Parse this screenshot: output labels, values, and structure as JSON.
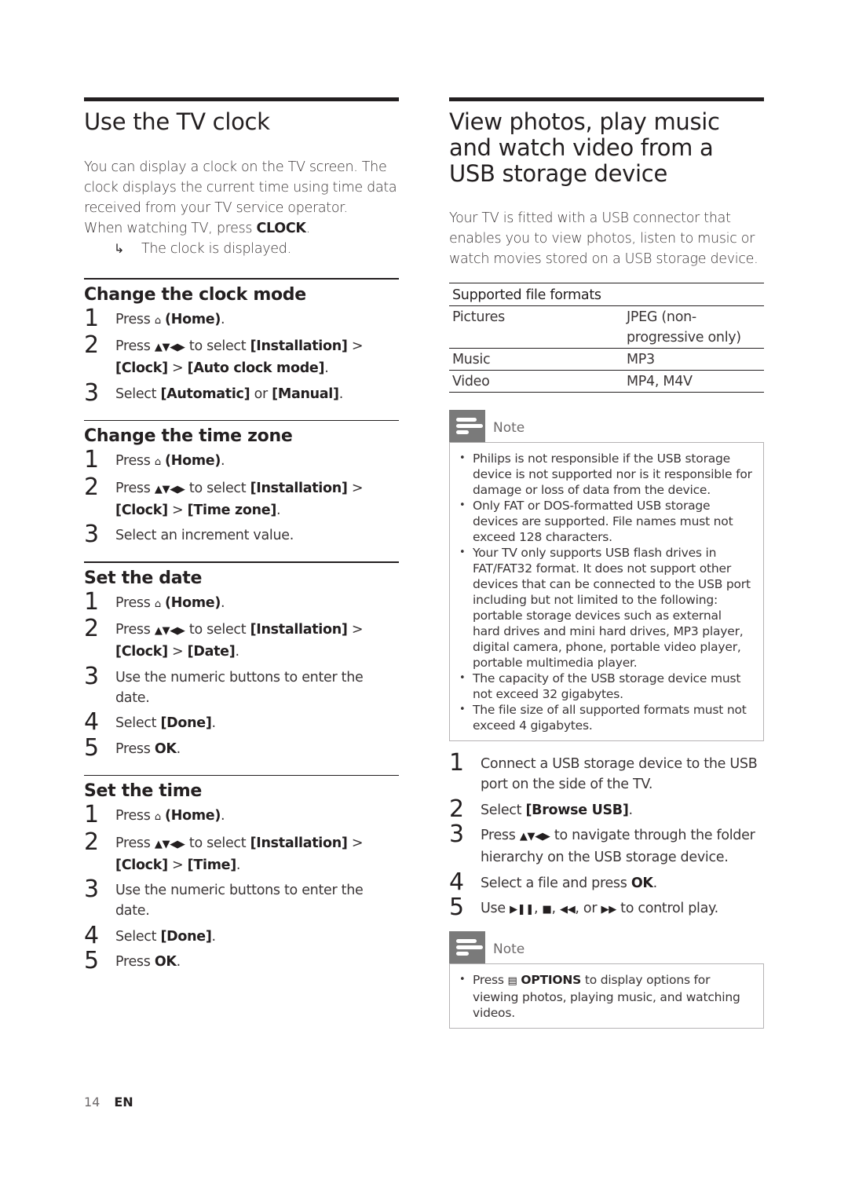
{
  "left": {
    "title": "Use the TV clock",
    "intro": "You can display a clock on the TV screen. The clock displays the current time using time data received from your TV service operator.",
    "intro_line2_prefix": "When watching TV, press ",
    "intro_line2_key": "CLOCK",
    "intro_line2_suffix": ".",
    "result_arrow": "↳",
    "result": "The clock is displayed.",
    "sections": [
      {
        "heading": "Change the clock mode",
        "steps": [
          {
            "num": "1",
            "pre": "Press ",
            "icon": "⌂",
            "key": "(Home)",
            "post": "."
          },
          {
            "num": "2",
            "pre": "Press ",
            "icon": "▲▼◀▶",
            "mid": " to select ",
            "path": "[Installation]",
            "sep": " > ",
            "path2": "[Clock]",
            "sep2": " > ",
            "path3": "[Auto clock mode]",
            "post": "."
          },
          {
            "num": "3",
            "pre": "Select ",
            "opt1": "[Automatic]",
            "mid": " or ",
            "opt2": "[Manual]",
            "post": "."
          }
        ]
      },
      {
        "heading": "Change the time zone",
        "steps": [
          {
            "num": "1",
            "pre": "Press ",
            "icon": "⌂",
            "key": "(Home)",
            "post": "."
          },
          {
            "num": "2",
            "pre": "Press ",
            "icon": "▲▼◀▶",
            "mid": " to select ",
            "path": "[Installation]",
            "sep": " > ",
            "path2": "[Clock]",
            "sep2": " > ",
            "path3": "[Time zone]",
            "post": "."
          },
          {
            "num": "3",
            "text": "Select an increment value."
          }
        ]
      },
      {
        "heading": "Set the date",
        "steps": [
          {
            "num": "1",
            "pre": "Press ",
            "icon": "⌂",
            "key": "(Home)",
            "post": "."
          },
          {
            "num": "2",
            "pre": "Press ",
            "icon": "▲▼◀▶",
            "mid": " to select ",
            "path": "[Installation]",
            "sep": " > ",
            "path2": "[Clock]",
            "sep2": " > ",
            "path3": "[Date]",
            "post": "."
          },
          {
            "num": "3",
            "text": "Use the numeric buttons to enter the date."
          },
          {
            "num": "4",
            "pre": "Select ",
            "key": "[Done]",
            "post": "."
          },
          {
            "num": "5",
            "pre": "Press ",
            "key": "OK",
            "post": "."
          }
        ]
      },
      {
        "heading": "Set the time",
        "steps": [
          {
            "num": "1",
            "pre": "Press ",
            "icon": "⌂",
            "key": "(Home)",
            "post": "."
          },
          {
            "num": "2",
            "pre": "Press ",
            "icon": "▲▼◀▶",
            "mid": " to select ",
            "path": "[Installation]",
            "sep": " > ",
            "path2": "[Clock]",
            "sep2": " > ",
            "path3": "[Time]",
            "post": "."
          },
          {
            "num": "3",
            "text": "Use the numeric buttons to enter the date."
          },
          {
            "num": "4",
            "pre": "Select ",
            "key": "[Done]",
            "post": "."
          },
          {
            "num": "5",
            "pre": "Press ",
            "key": "OK",
            "post": "."
          }
        ]
      }
    ]
  },
  "right": {
    "title": "View photos, play music and watch video from a USB storage device",
    "intro": "Your TV is fitted with a USB connector that enables you to view photos, listen to music or watch movies stored on a USB storage device.",
    "table": {
      "header": "Supported file formats",
      "rows": [
        {
          "type": "Pictures",
          "formats": "JPEG (non-progressive only)"
        },
        {
          "type": "Music",
          "formats": "MP3"
        },
        {
          "type": "Video",
          "formats": "MP4, M4V"
        }
      ]
    },
    "note1": {
      "label": "Note",
      "items": [
        "Philips is not responsible if the USB storage device is not supported nor is it responsible for damage or loss of data from the device.",
        "Only FAT or DOS-formatted USB storage devices are supported. File names must not exceed 128 characters.",
        "Your TV only supports USB flash drives in FAT/FAT32 format. It does not support other devices that can be connected to the USB port including but not limited to the following: portable storage devices such as external hard drives and mini hard drives, MP3 player, digital camera, phone, portable video player, portable multimedia player.",
        "The capacity of the USB storage device must not exceed 32 gigabytes.",
        "The file size of all supported formats must not exceed 4 gigabytes."
      ]
    },
    "steps": [
      {
        "num": "1",
        "text": "Connect a USB storage device to the USB port on the side of the TV."
      },
      {
        "num": "2",
        "pre": "Select ",
        "key": "[Browse USB]",
        "post": "."
      },
      {
        "num": "3",
        "pre": "Press ",
        "icon": "▲▼◀▶",
        "post": " to navigate through the folder hierarchy on the USB storage device."
      },
      {
        "num": "4",
        "pre": "Select a file and press ",
        "key": "OK",
        "post": "."
      },
      {
        "num": "5",
        "pre": "Use ",
        "play_icon": "▶❚❚",
        "c1": ", ",
        "stop_icon": "■",
        "c2": ", ",
        "rew_icon": "◀◀",
        "c3": ", or ",
        "ff_icon": "▶▶",
        "post": " to control play."
      }
    ],
    "note2": {
      "label": "Note",
      "pre": "Press ",
      "icon": "▤",
      "key": "OPTIONS",
      "post": " to display options for viewing photos, playing music, and watching videos."
    }
  },
  "footer": {
    "page_number": "14",
    "language": "EN"
  }
}
